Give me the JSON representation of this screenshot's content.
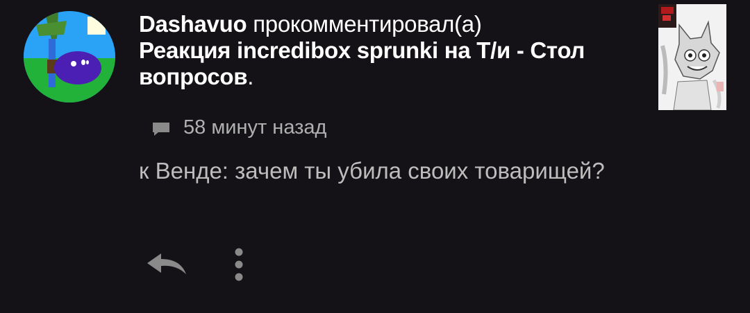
{
  "notification": {
    "author": "Dashavuo",
    "action": " прокомментировал(а)",
    "post_title": "Реакция incredibox sprunki на Т/и - Стол вопросов",
    "post_title_end": ".",
    "time": "58 минут назад",
    "comment": "к Венде: зачем ты убила своих товарищей?"
  },
  "icons": {
    "avatar": "user-avatar",
    "thumbnail": "post-thumbnail",
    "comment": "comment-bubble-icon",
    "reply": "reply-arrow-icon",
    "more": "more-vertical-icon"
  },
  "colors": {
    "background": "#141216",
    "primary_text": "#ffffff",
    "secondary_text": "#b0b0b0",
    "icon": "#8a8a8a"
  }
}
